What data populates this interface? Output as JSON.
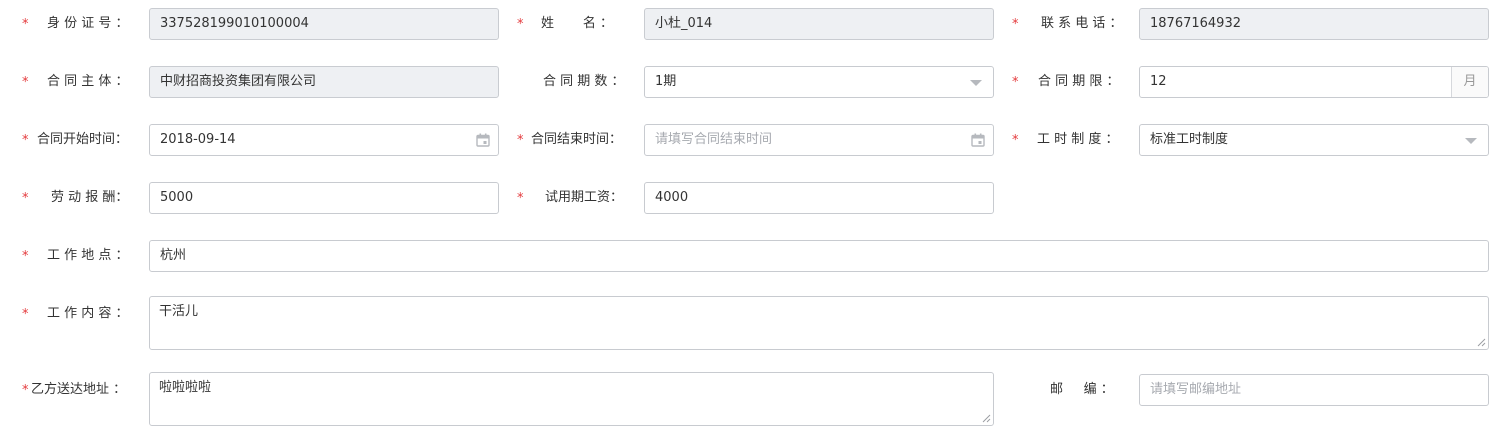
{
  "form": {
    "id_number": {
      "label": "身 份 证 号 ：",
      "value": "337528199010100004"
    },
    "name": {
      "label": "姓       名 ：",
      "value": "小杜_014"
    },
    "phone": {
      "label": "联 系 电 话 ：",
      "value": "18767164932"
    },
    "contract_entity": {
      "label": "合 同 主 体 ：",
      "value": "中财招商投资集团有限公司"
    },
    "contract_periods": {
      "label": "合 同 期 数 ：",
      "value": "1期"
    },
    "contract_term": {
      "label": "合 同 期 限 ：",
      "value": "12",
      "unit": "月"
    },
    "start_date": {
      "label": "合同开始时间：",
      "value": "2018-09-14"
    },
    "end_date": {
      "label": "合同结束时间：",
      "placeholder": "请填写合同结束时间"
    },
    "work_hours_system": {
      "label": "工 时 制 度 ：",
      "value": "标准工时制度"
    },
    "salary": {
      "label": "劳 动 报 酬：",
      "value": "5000"
    },
    "probation_salary": {
      "label": "试用期工资：",
      "value": "4000"
    },
    "work_location": {
      "label": "工 作 地 点 ：",
      "value": "杭州"
    },
    "work_content": {
      "label": "工 作 内 容 ：",
      "value": "干活儿"
    },
    "delivery_address": {
      "label": "乙方送达地址 ：",
      "value": "啦啦啦啦"
    },
    "postcode": {
      "label": "邮     编 ：",
      "placeholder": "请填写邮编地址"
    }
  },
  "required_mark": "*",
  "colors": {
    "required": "#e4393c",
    "readonly_bg": "#eef0f3",
    "border": "#c8cbd0",
    "placeholder": "#a7aab0"
  },
  "icons": {
    "date_picker": "calendar-icon",
    "select": "caret-down-icon",
    "textarea": "resize-handle-icon"
  }
}
